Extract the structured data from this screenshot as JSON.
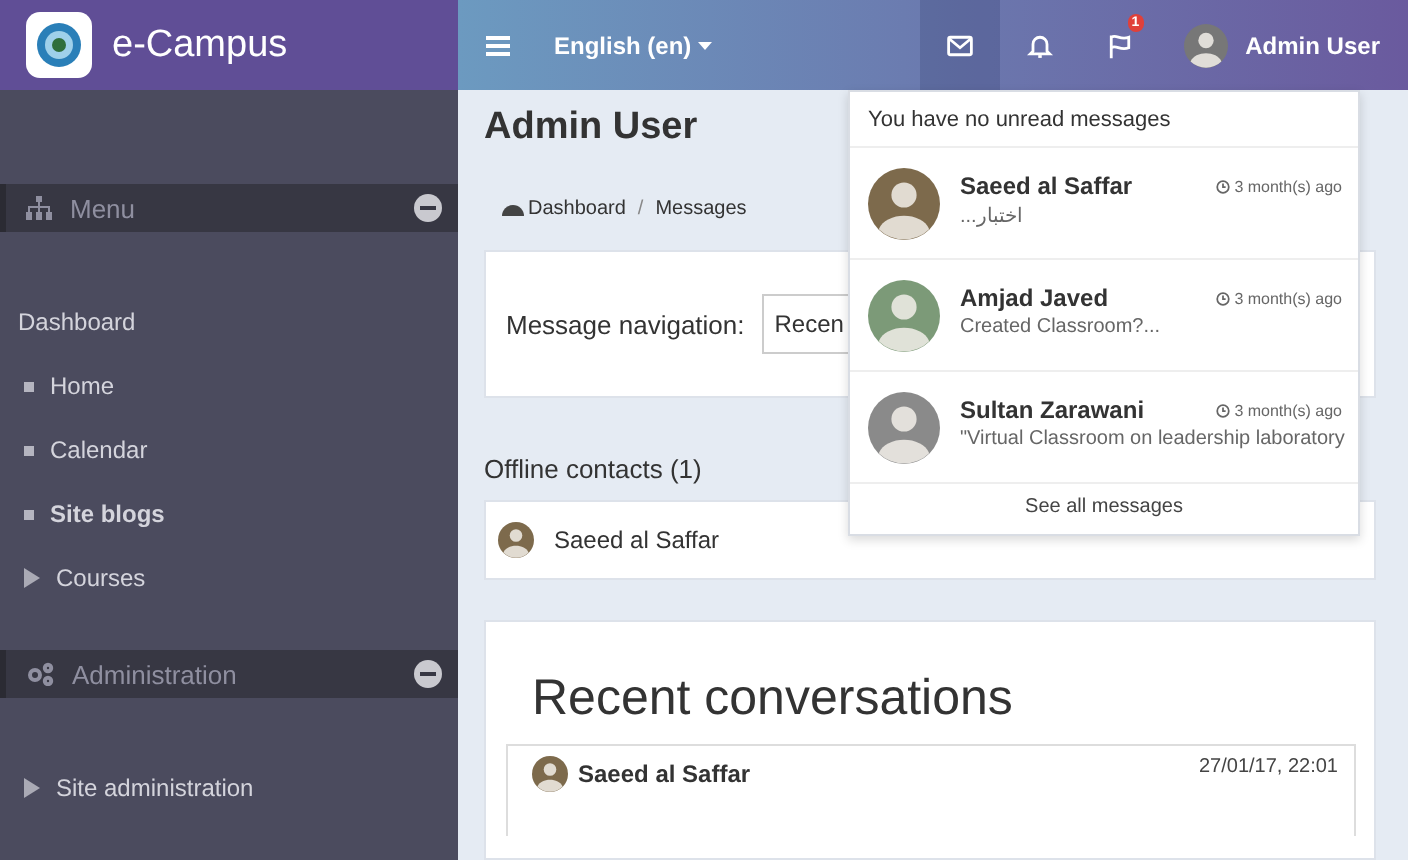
{
  "brand": {
    "title": "e-Campus"
  },
  "topbar": {
    "language": "English (en)",
    "user": "Admin User",
    "icons": [
      {
        "kind": "mail",
        "selected": true
      },
      {
        "kind": "bell",
        "selected": false
      },
      {
        "kind": "flag",
        "selected": false,
        "badge": "1"
      }
    ]
  },
  "sidebar": {
    "blocks": [
      {
        "title": "Menu",
        "expanded": true,
        "items": [
          {
            "kind": "heading",
            "label": "Dashboard",
            "selected": false
          },
          {
            "kind": "leaf",
            "label": "Home",
            "selected": false
          },
          {
            "kind": "leaf",
            "label": "Calendar",
            "selected": false
          },
          {
            "kind": "leaf",
            "label": "Site blogs",
            "selected": true
          },
          {
            "kind": "branch",
            "label": "Courses",
            "selected": false
          }
        ]
      },
      {
        "title": "Administration",
        "expanded": true,
        "items": [
          {
            "kind": "branch",
            "label": "Site administration",
            "selected": false
          }
        ]
      }
    ]
  },
  "page": {
    "title": "Admin User",
    "breadcrumb": {
      "items": [
        "Dashboard",
        "Messages"
      ],
      "separator": "/"
    },
    "navigation": {
      "label": "Message navigation:",
      "value": "Recen"
    },
    "offline": {
      "title": "Offline contacts (1)",
      "contacts": [
        "Saeed al Saffar"
      ]
    },
    "recent": {
      "title": "Recent conversations",
      "rows": [
        {
          "name": "Saeed al Saffar",
          "time": "27/01/17, 22:01"
        }
      ]
    }
  },
  "messages_popover": {
    "header": "You have no unread messages",
    "items": [
      {
        "name": "Saeed al Saffar",
        "time": "3 month(s) ago",
        "preview": "اختبار..."
      },
      {
        "name": "Amjad Javed",
        "time": "3 month(s) ago",
        "preview": "Created Classroom?..."
      },
      {
        "name": "Sultan Zarawani",
        "time": "3 month(s) ago",
        "preview": "\"Virtual Classroom on leadership laboratory"
      }
    ],
    "footer": "See all messages"
  }
}
